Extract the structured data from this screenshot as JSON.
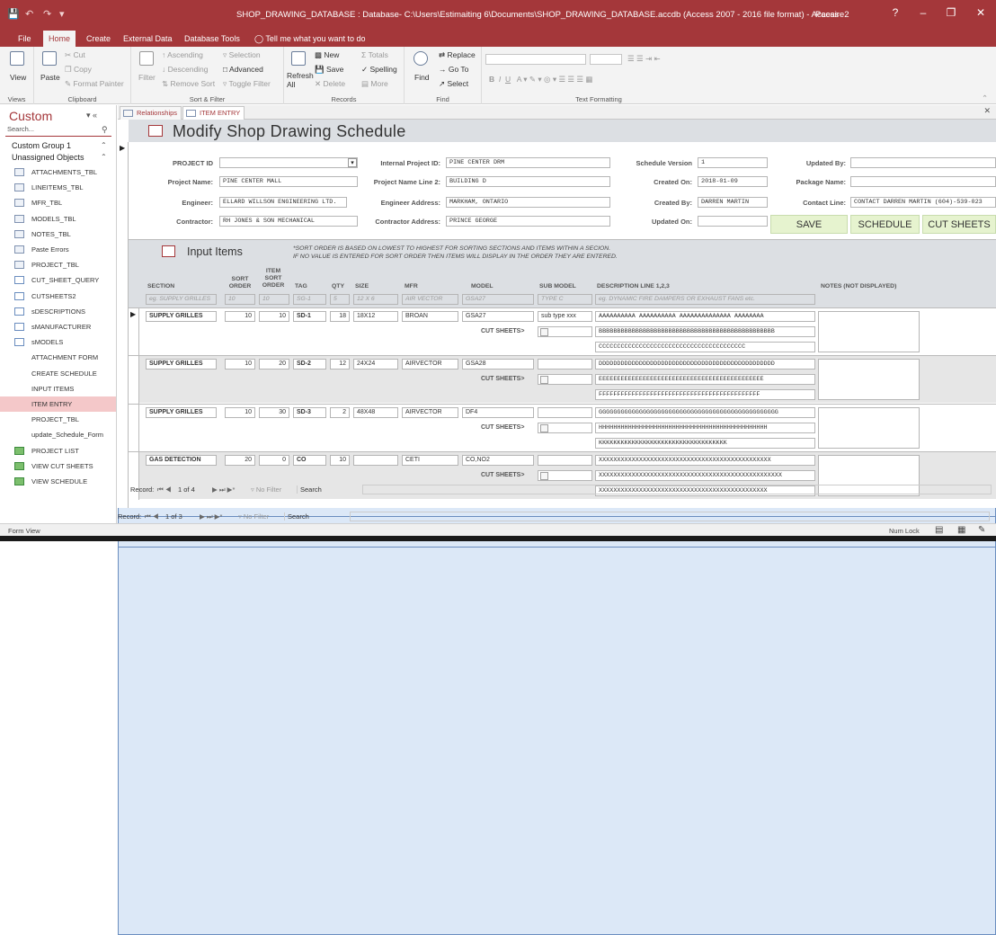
{
  "titlebar": {
    "title": "SHOP_DRAWING_DATABASE : Database- C:\\Users\\Estimaiting 6\\Documents\\SHOP_DRAWING_DATABASE.accdb (Access 2007 - 2016 file format)  -  Access",
    "user": "Pacaire2",
    "help": "?"
  },
  "menu": {
    "file": "File",
    "home": "Home",
    "create": "Create",
    "external": "External Data",
    "dbtools": "Database Tools",
    "tellme": "Tell me what you want to do"
  },
  "ribbon": {
    "views": {
      "view": "View",
      "label": "Views"
    },
    "clipboard": {
      "paste": "Paste",
      "cut": "Cut",
      "copy": "Copy",
      "format_painter": "Format Painter",
      "label": "Clipboard"
    },
    "sort": {
      "filter": "Filter",
      "ascending": "Ascending",
      "descending": "Descending",
      "remove_sort": "Remove Sort",
      "selection": "Selection",
      "advanced": "Advanced",
      "toggle_filter": "Toggle Filter",
      "label": "Sort & Filter"
    },
    "records": {
      "refresh": "Refresh",
      "all": "All",
      "new": "New",
      "save": "Save",
      "delete": "Delete",
      "totals": "Totals",
      "spelling": "Spelling",
      "more": "More",
      "label": "Records"
    },
    "find": {
      "find": "Find",
      "replace": "Replace",
      "goto": "Go To",
      "select": "Select",
      "label": "Find"
    },
    "text": {
      "label": "Text Formatting"
    }
  },
  "nav": {
    "title": "Custom",
    "search": "Search...",
    "group1": "Custom Group 1",
    "group2": "Unassigned Objects",
    "items": [
      {
        "label": "ATTACHMENTS_TBL",
        "type": "table"
      },
      {
        "label": "LINEITEMS_TBL",
        "type": "table"
      },
      {
        "label": "MFR_TBL",
        "type": "table"
      },
      {
        "label": "MODELS_TBL",
        "type": "table"
      },
      {
        "label": "NOTES_TBL",
        "type": "table"
      },
      {
        "label": "Paste Errors",
        "type": "table"
      },
      {
        "label": "PROJECT_TBL",
        "type": "table"
      },
      {
        "label": "CUT_SHEET_QUERY",
        "type": "query"
      },
      {
        "label": "CUTSHEETS2",
        "type": "query"
      },
      {
        "label": "sDESCRIPTIONS",
        "type": "query"
      },
      {
        "label": "sMANUFACTURER",
        "type": "query"
      },
      {
        "label": "sMODELS",
        "type": "query"
      },
      {
        "label": "ATTACHMENT FORM",
        "type": "form"
      },
      {
        "label": "CREATE SCHEDULE",
        "type": "form"
      },
      {
        "label": "INPUT ITEMS",
        "type": "form"
      },
      {
        "label": "ITEM ENTRY",
        "type": "form"
      },
      {
        "label": "PROJECT_TBL",
        "type": "form"
      },
      {
        "label": "update_Schedule_Form",
        "type": "form"
      },
      {
        "label": "PROJECT LIST",
        "type": "macro"
      },
      {
        "label": "VIEW CUT SHEETS",
        "type": "macro"
      },
      {
        "label": "VIEW SCHEDULE",
        "type": "macro"
      }
    ]
  },
  "tabs": {
    "relationships": "Relationships",
    "item_entry": "ITEM ENTRY"
  },
  "form": {
    "title": "Modify Shop Drawing Schedule",
    "labels": {
      "project_id": "PROJECT ID",
      "internal_id": "Internal Project ID:",
      "schedule_version": "Schedule Version",
      "updated_by": "Updated By:",
      "project_name": "Project Name:",
      "project_name2": "Project Name Line 2:",
      "created_on": "Created On:",
      "package_name": "Package Name:",
      "engineer": "Engineer:",
      "engineer_address": "Engineer Address:",
      "created_by": "Created By:",
      "contact_line": "Contact Line:",
      "contractor": "Contractor:",
      "contractor_address": "Contractor Address:",
      "updated_on": "Updated On:"
    },
    "values": {
      "project_id": "",
      "internal_id": "PINE CENTER DRM",
      "schedule_version": "1",
      "updated_by": "",
      "project_name": "PINE CENTER MALL",
      "project_name2": "BUILDING D",
      "created_on": "2018-01-09",
      "package_name": "",
      "engineer": "ELLARD WILLSON ENGINEERING LTD.",
      "engineer_address": "MARKHAM, ONTARIO",
      "created_by": "DARREN MARTIN",
      "contact_line": "CONTACT DARREN MARTIN (604)-539-023",
      "contractor": "RH JONES & SON MECHANICAL",
      "contractor_address": "PRINCE GEORGE",
      "updated_on": ""
    },
    "buttons": {
      "save": "SAVE",
      "schedule": "SCHEDULE",
      "cut_sheets": "CUT SHEETS"
    }
  },
  "items": {
    "title": "Input Items",
    "note1": "*SORT ORDER IS BASED ON LOWEST TO HIGHEST FOR SORTING SECTIONS AND ITEMS WITHIN A SECION.",
    "note2": "IF NO VALUE IS ENTERED FOR SORT ORDER THEN ITEMS WILL DISPLAY IN THE ORDER THEY ARE ENTERED.",
    "headers": {
      "section": "SECTION",
      "sort_order": "SORT ORDER",
      "item_sort_order": "ITEM SORT ORDER",
      "tag": "TAG",
      "qty": "QTY",
      "size": "SIZE",
      "mfr": "MFR",
      "model": "MODEL",
      "sub_model": "SUB MODEL",
      "description": "DESCRIPTION LINE 1,2,3",
      "notes": "NOTES (NOT DISPLAYED)"
    },
    "placeholders": {
      "section": "eg. SUPPLY GRILLES",
      "sort": "10",
      "item_sort": "10",
      "tag": "SG-1",
      "qty": "5",
      "size": "12 X 6",
      "mfr": "AIR VECTOR",
      "model": "GSA27",
      "sub_model": "TYPE C",
      "description": "eg. DYNAMIC FIRE DAMPERS OR EXHAUST FANS etc."
    },
    "cut_sheets_label": "CUT SHEETS>",
    "rows": [
      {
        "section": "SUPPLY GRILLES",
        "sort": "10",
        "item_sort": "10",
        "tag": "SD-1",
        "qty": "18",
        "size": "18X12",
        "mfr": "BROAN",
        "model": "GSA27",
        "sub_model": "sub type xxx",
        "d1": "AAAAAAAAAA AAAAAAAAAA AAAAAAAAAAAAAA AAAAAAAA",
        "d2": "BBBBBBBBBBBBBBBBBBBBBBBBBBBBBBBBBBBBBBBBBBBBBBBB",
        "d3": "CCCCCCCCCCCCCCCCCCCCCCCCCCCCCCCCCCCCCCCC"
      },
      {
        "section": "SUPPLY GRILLES",
        "sort": "10",
        "item_sort": "20",
        "tag": "SD-2",
        "qty": "12",
        "size": "24X24",
        "mfr": "AIRVECTOR",
        "model": "GSA28",
        "sub_model": "",
        "d1": "DDDDDDDDDDDDDDDDDDDDDDDDDDDDDDDDDDDDDDDDDDDDDDDD",
        "d2": "EEEEEEEEEEEEEEEEEEEEEEEEEEEEEEEEEEEEEEEEEEEEE",
        "d3": "FFFFFFFFFFFFFFFFFFFFFFFFFFFFFFFFFFFFFFFFFFFF"
      },
      {
        "section": "SUPPLY GRILLES",
        "sort": "10",
        "item_sort": "30",
        "tag": "SD-3",
        "qty": "2",
        "size": "48X48",
        "mfr": "AIRVECTOR",
        "model": "DF4",
        "sub_model": "",
        "d1": "GGGGGGGGGGGGGGGGGGGGGGGGGGGGGGGGGGGGGGGGGGGGGGGGG",
        "d2": "HHHHHHHHHHHHHHHHHHHHHHHHHHHHHHHHHHHHHHHHHHHHHH",
        "d3": "KKKKKKKKKKKKKKKKKKKKKKKKKKKKKKKKKKK"
      },
      {
        "section": "GAS DETECTION",
        "sort": "20",
        "item_sort": "0",
        "tag": "CO",
        "qty": "10",
        "size": "",
        "mfr": "CETI",
        "model": "CO,NO2",
        "sub_model": "",
        "d1": "XXXXXXXXXXXXXXXXXXXXXXXXXXXXXXXXXXXXXXXXXXXXXXX",
        "d2": "XXXXXXXXXXXXXXXXXXXXXXXXXXXXXXXXXXXXXXXXXXXXXXXXXX",
        "d3": "XXXXXXXXXXXXXXXXXXXXXXXXXXXXXXXXXXXXXXXXXXXXXX"
      }
    ]
  },
  "subnav": {
    "record": "Record:",
    "pos": "1 of 4",
    "nofilter": "No Filter",
    "search": "Search"
  },
  "mainnav": {
    "record": "Record:",
    "pos": "1 of 3",
    "nofilter": "No Filter",
    "search": "Search"
  },
  "status": {
    "left": "Form View",
    "numlock": "Num Lock"
  }
}
